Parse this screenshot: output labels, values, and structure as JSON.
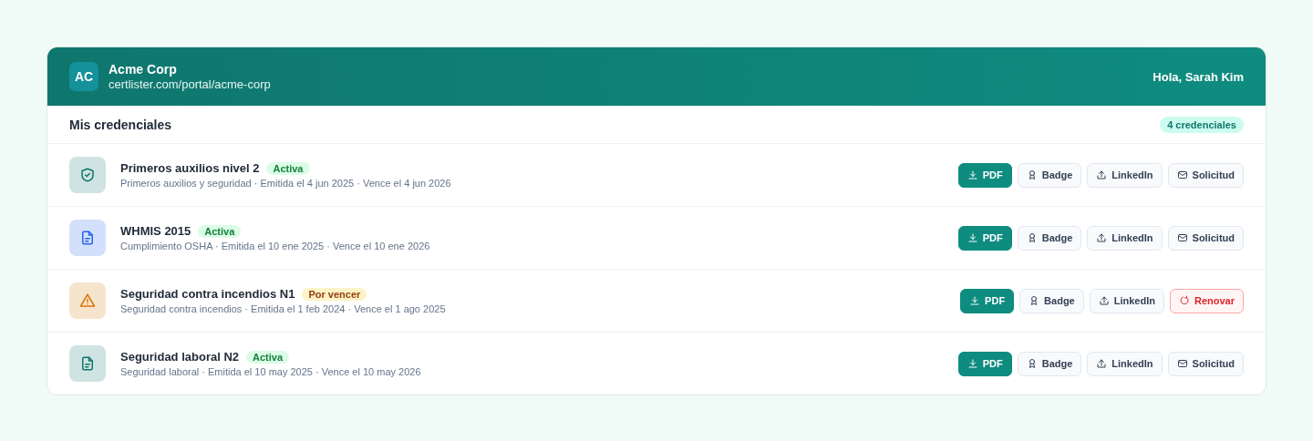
{
  "header": {
    "initials": "AC",
    "company": "Acme Corp",
    "url": "certlister.com/portal/acme-corp",
    "greeting": "Hola, Sarah Kim"
  },
  "section": {
    "title": "Mis credenciales",
    "count": "4 credenciales"
  },
  "credentials": [
    {
      "kind": "shield",
      "color": "#0f766e",
      "name": "Primeros auxilios nivel 2",
      "status": {
        "kind": "active",
        "label": "Activa"
      },
      "meta": "Primeros auxilios y seguridad · Emitida el 4 jun 2025 · Vence el 4 jun 2026",
      "actions": [
        {
          "kind": "download",
          "label": "PDF"
        },
        {
          "kind": "badge",
          "label": "Badge"
        },
        {
          "kind": "upload",
          "label": "LinkedIn"
        },
        {
          "kind": "mail",
          "label": "Solicitud"
        }
      ]
    },
    {
      "kind": "document",
      "color": "#2563eb",
      "name": "WHMIS 2015",
      "status": {
        "kind": "active",
        "label": "Activa"
      },
      "meta": "Cumplimiento OSHA · Emitida el 10 ene 2025 · Vence el 10 ene 2026",
      "actions": [
        {
          "kind": "download",
          "label": "PDF"
        },
        {
          "kind": "badge",
          "label": "Badge"
        },
        {
          "kind": "upload",
          "label": "LinkedIn"
        },
        {
          "kind": "mail",
          "label": "Solicitud"
        }
      ]
    },
    {
      "kind": "warning",
      "color": "#d97706",
      "name": "Seguridad contra incendios N1",
      "status": {
        "kind": "expiring",
        "label": "Por vencer"
      },
      "meta": "Seguridad contra incendios · Emitida el 1 feb 2024 · Vence el 1 ago 2025",
      "actions": [
        {
          "kind": "download",
          "label": "PDF"
        },
        {
          "kind": "badge",
          "label": "Badge"
        },
        {
          "kind": "upload",
          "label": "LinkedIn"
        },
        {
          "kind": "renew",
          "label": "Renovar"
        }
      ]
    },
    {
      "kind": "document",
      "color": "#0f766e",
      "name": "Seguridad laboral N2",
      "status": {
        "kind": "active",
        "label": "Activa"
      },
      "meta": "Seguridad laboral · Emitida el 10 may 2025 · Vence el 10 may 2026",
      "actions": [
        {
          "kind": "download",
          "label": "PDF"
        },
        {
          "kind": "badge",
          "label": "Badge"
        },
        {
          "kind": "upload",
          "label": "LinkedIn"
        },
        {
          "kind": "mail",
          "label": "Solicitud"
        }
      ]
    }
  ]
}
